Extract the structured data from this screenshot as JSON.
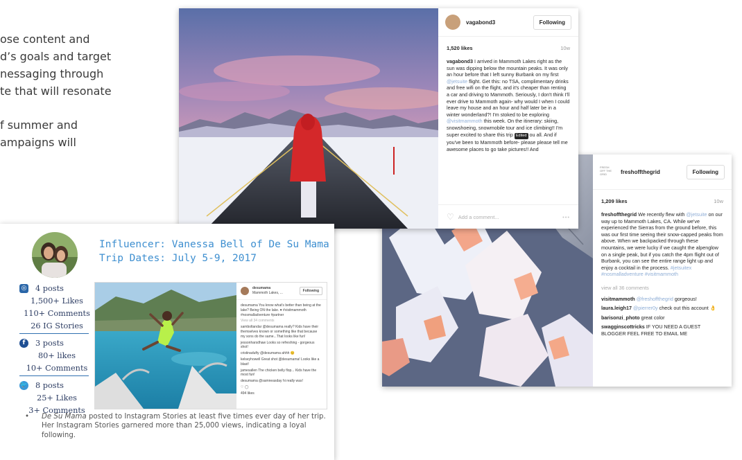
{
  "background_text": {
    "lines": [
      "ose content and",
      "d’s goals and target",
      "nessaging through",
      "te that will resonate",
      "",
      "f summer and",
      "ampaigns will"
    ]
  },
  "post1": {
    "username": "vagabond3",
    "follow_label": "Following",
    "likes": "1,520 likes",
    "age": "10w",
    "caption": {
      "user": "vagabond3",
      "t1": " I arrived in Mammoth Lakes right as the sun was dipping below the mountain peaks. It was only an hour before that I left sunny Burbank on my first ",
      "tag1": "@jetsuite",
      "t2": " flight. Get this: no TSA, complimentary drinks and free wifi on the flight, and it's cheaper than renting a car and driving to Mammoth. Seriously, I don't think I'll ever drive to Mammoth again- why would I when I could leave my house and an hour and half later be in a winter wonderland?! I'm stoked to be exploring ",
      "tag2": "@visitmammoth",
      "t3": " this week. On the itinerary: skiing, snowshoeing, snowmobile tour and ice climbing!! I'm super excited to share this trip ",
      "edited": "Edited",
      "t4": " ou all. And if you've been to Mammoth before- please please tell me awesome places to go take pictures!! And"
    },
    "comment_placeholder": "Add a comment..."
  },
  "post2": {
    "logo_text": "FRESH OFF THE GRID",
    "username": "freshoffthegrid",
    "follow_label": "Following",
    "likes": "1,209 likes",
    "age": "10w",
    "caption": {
      "user": "freshoffthegrid",
      "t1": " We recently flew with ",
      "tag1": "@jetsuite",
      "t2": " on our way up to Mammoth Lakes, CA. While we've experienced the Sierras from the ground before, this was our first time seeing their snow-capped peaks from above. When we backpacked through these mountains, we were lucky if we caught the alpenglow on a single peak, but if you catch the 4pm flight out of Burbank, you can see the entire range light up and enjoy a cocktail in the process. ",
      "tags": "#jetsuitex #nosmalladventure #visitmammoth"
    },
    "view_all": "view all 36 comments",
    "comments": [
      {
        "user": "visitmammoth",
        "at": "@freshoffthegrid",
        "text": " gorgeous!"
      },
      {
        "user": "laura.leigh17",
        "at": "@pierrer0y",
        "text": " check out this account 👌"
      },
      {
        "user": "barisonzi_photo",
        "at": "",
        "text": " great color"
      },
      {
        "user": "swagginscottricks",
        "at": "",
        "text": " IF YOU NEED A GUEST BLOGGER FEEL FREE TO EMAIL ME"
      }
    ]
  },
  "report": {
    "title_line1": "Influencer: Vanessa Bell of De Su Mama",
    "title_line2": "Trip Dates: July 5-9, 2017",
    "instagram": {
      "posts": "4 posts",
      "likes": "1,500+ Likes",
      "comments": "110+ Comments",
      "stories": "26 IG Stories"
    },
    "facebook": {
      "posts": "3 posts",
      "likes": "80+ likes",
      "comments": "10+ Comments"
    },
    "twitter": {
      "posts": "8 posts",
      "likes": "25+ Likes",
      "comments": "3+ Comments"
    },
    "inner_post": {
      "username": "desumama",
      "location": "Mammoth Lakes, ...",
      "follow_label": "Following",
      "caption": "desumama You know what's better than being at the lake? Being ON the lake. ♥ #visitmammoth #nosmalladventure #partner",
      "view_all": "View all 34 comments",
      "comments": [
        "samboltandar @desumama really? Kids have their themselves known or something like that because my sons do the same...That looks like fun!",
        "jessonharsdhaw Looks so refreshing - gorgeous shot!",
        "cristinadufty @desumama ahhh 😊",
        "kelseyhowell Great shot @desumama! Looks like a blast!",
        "jamesallen The chicken belly flop... Kids have the most fun!",
        "desumama @samneasday hi really was!"
      ],
      "likes": "494 likes"
    },
    "bullet": {
      "name": "De Su Mama",
      "text": " posted to Instagram Stories at least five times ever day of her trip. Her Instagram Stories garnered more than 25,000 views, indicating a loyal following."
    }
  }
}
